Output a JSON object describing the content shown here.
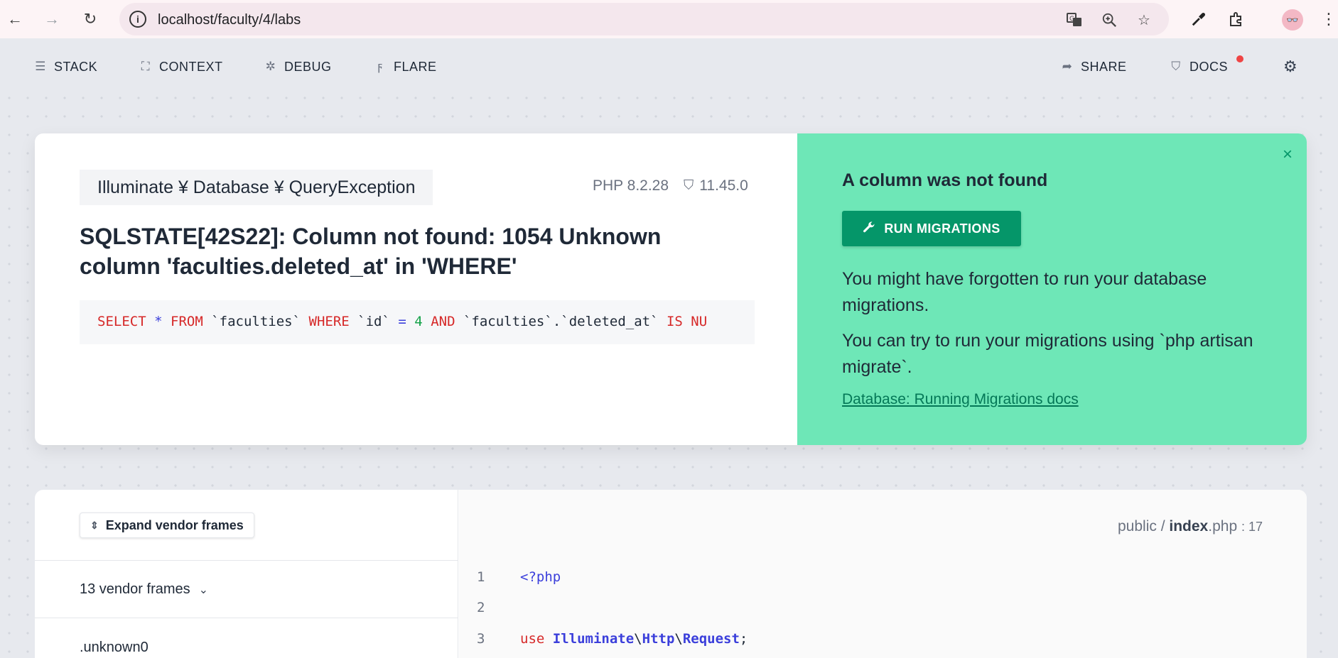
{
  "browser": {
    "url": "localhost/faculty/4/labs",
    "back_icon": "←",
    "forward_icon": "→",
    "reload_icon": "↻"
  },
  "toolbar": {
    "stack": "STACK",
    "context": "CONTEXT",
    "debug": "DEBUG",
    "flare": "FLARE",
    "share": "SHARE",
    "docs": "DOCS"
  },
  "error": {
    "exception_class": "Illuminate ¥ Database ¥ QueryException",
    "php_version": "PHP 8.2.28",
    "laravel_version": "11.45.0",
    "message": "SQLSTATE[42S22]: Column not found: 1054 Unknown column 'faculties.deleted_at' in 'WHERE'",
    "sql": {
      "select": "SELECT",
      "star": "*",
      "from": "FROM",
      "table": "`faculties`",
      "where": "WHERE",
      "col_id": "`id`",
      "eq": "=",
      "num": "4",
      "and": "AND",
      "col_deleted": "`faculties`.`deleted_at`",
      "is_null": "IS NU"
    }
  },
  "solution": {
    "title": "A column was not found",
    "button": "RUN MIGRATIONS",
    "text1": "You might have forgotten to run your database migrations.",
    "text2": "You can try to run your migrations using `php artisan migrate`.",
    "link": "Database: Running Migrations docs",
    "close": "×",
    "accent_color": "#6ee7b7",
    "button_color": "#059669"
  },
  "stack": {
    "expand_label": "Expand vendor frames",
    "vendor_frames": "13 vendor frames",
    "unknown_frame": ".unknown0",
    "file_dir": "public /",
    "file_name": "index",
    "file_ext": ".php",
    "file_line": ": 17",
    "code": [
      {
        "num": "1",
        "text": "<?php"
      },
      {
        "num": "2",
        "text": ""
      },
      {
        "num": "3",
        "use": "use",
        "ns": "Illuminate",
        "sep1": "\\",
        "ns2": "Http",
        "sep2": "\\",
        "cls": "Request",
        "end": ";"
      }
    ]
  }
}
